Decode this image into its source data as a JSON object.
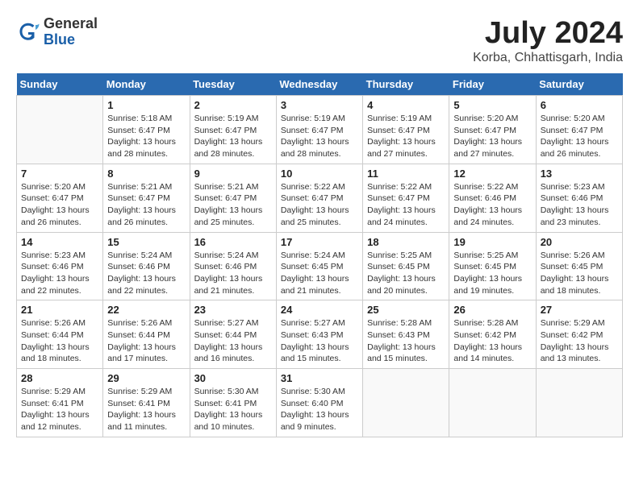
{
  "header": {
    "logo_general": "General",
    "logo_blue": "Blue",
    "month_year": "July 2024",
    "location": "Korba, Chhattisgarh, India"
  },
  "weekdays": [
    "Sunday",
    "Monday",
    "Tuesday",
    "Wednesday",
    "Thursday",
    "Friday",
    "Saturday"
  ],
  "weeks": [
    [
      {
        "day": "",
        "info": ""
      },
      {
        "day": "1",
        "info": "Sunrise: 5:18 AM\nSunset: 6:47 PM\nDaylight: 13 hours\nand 28 minutes."
      },
      {
        "day": "2",
        "info": "Sunrise: 5:19 AM\nSunset: 6:47 PM\nDaylight: 13 hours\nand 28 minutes."
      },
      {
        "day": "3",
        "info": "Sunrise: 5:19 AM\nSunset: 6:47 PM\nDaylight: 13 hours\nand 28 minutes."
      },
      {
        "day": "4",
        "info": "Sunrise: 5:19 AM\nSunset: 6:47 PM\nDaylight: 13 hours\nand 27 minutes."
      },
      {
        "day": "5",
        "info": "Sunrise: 5:20 AM\nSunset: 6:47 PM\nDaylight: 13 hours\nand 27 minutes."
      },
      {
        "day": "6",
        "info": "Sunrise: 5:20 AM\nSunset: 6:47 PM\nDaylight: 13 hours\nand 26 minutes."
      }
    ],
    [
      {
        "day": "7",
        "info": "Sunrise: 5:20 AM\nSunset: 6:47 PM\nDaylight: 13 hours\nand 26 minutes."
      },
      {
        "day": "8",
        "info": "Sunrise: 5:21 AM\nSunset: 6:47 PM\nDaylight: 13 hours\nand 26 minutes."
      },
      {
        "day": "9",
        "info": "Sunrise: 5:21 AM\nSunset: 6:47 PM\nDaylight: 13 hours\nand 25 minutes."
      },
      {
        "day": "10",
        "info": "Sunrise: 5:22 AM\nSunset: 6:47 PM\nDaylight: 13 hours\nand 25 minutes."
      },
      {
        "day": "11",
        "info": "Sunrise: 5:22 AM\nSunset: 6:47 PM\nDaylight: 13 hours\nand 24 minutes."
      },
      {
        "day": "12",
        "info": "Sunrise: 5:22 AM\nSunset: 6:46 PM\nDaylight: 13 hours\nand 24 minutes."
      },
      {
        "day": "13",
        "info": "Sunrise: 5:23 AM\nSunset: 6:46 PM\nDaylight: 13 hours\nand 23 minutes."
      }
    ],
    [
      {
        "day": "14",
        "info": "Sunrise: 5:23 AM\nSunset: 6:46 PM\nDaylight: 13 hours\nand 22 minutes."
      },
      {
        "day": "15",
        "info": "Sunrise: 5:24 AM\nSunset: 6:46 PM\nDaylight: 13 hours\nand 22 minutes."
      },
      {
        "day": "16",
        "info": "Sunrise: 5:24 AM\nSunset: 6:46 PM\nDaylight: 13 hours\nand 21 minutes."
      },
      {
        "day": "17",
        "info": "Sunrise: 5:24 AM\nSunset: 6:45 PM\nDaylight: 13 hours\nand 21 minutes."
      },
      {
        "day": "18",
        "info": "Sunrise: 5:25 AM\nSunset: 6:45 PM\nDaylight: 13 hours\nand 20 minutes."
      },
      {
        "day": "19",
        "info": "Sunrise: 5:25 AM\nSunset: 6:45 PM\nDaylight: 13 hours\nand 19 minutes."
      },
      {
        "day": "20",
        "info": "Sunrise: 5:26 AM\nSunset: 6:45 PM\nDaylight: 13 hours\nand 18 minutes."
      }
    ],
    [
      {
        "day": "21",
        "info": "Sunrise: 5:26 AM\nSunset: 6:44 PM\nDaylight: 13 hours\nand 18 minutes."
      },
      {
        "day": "22",
        "info": "Sunrise: 5:26 AM\nSunset: 6:44 PM\nDaylight: 13 hours\nand 17 minutes."
      },
      {
        "day": "23",
        "info": "Sunrise: 5:27 AM\nSunset: 6:44 PM\nDaylight: 13 hours\nand 16 minutes."
      },
      {
        "day": "24",
        "info": "Sunrise: 5:27 AM\nSunset: 6:43 PM\nDaylight: 13 hours\nand 15 minutes."
      },
      {
        "day": "25",
        "info": "Sunrise: 5:28 AM\nSunset: 6:43 PM\nDaylight: 13 hours\nand 15 minutes."
      },
      {
        "day": "26",
        "info": "Sunrise: 5:28 AM\nSunset: 6:42 PM\nDaylight: 13 hours\nand 14 minutes."
      },
      {
        "day": "27",
        "info": "Sunrise: 5:29 AM\nSunset: 6:42 PM\nDaylight: 13 hours\nand 13 minutes."
      }
    ],
    [
      {
        "day": "28",
        "info": "Sunrise: 5:29 AM\nSunset: 6:41 PM\nDaylight: 13 hours\nand 12 minutes."
      },
      {
        "day": "29",
        "info": "Sunrise: 5:29 AM\nSunset: 6:41 PM\nDaylight: 13 hours\nand 11 minutes."
      },
      {
        "day": "30",
        "info": "Sunrise: 5:30 AM\nSunset: 6:41 PM\nDaylight: 13 hours\nand 10 minutes."
      },
      {
        "day": "31",
        "info": "Sunrise: 5:30 AM\nSunset: 6:40 PM\nDaylight: 13 hours\nand 9 minutes."
      },
      {
        "day": "",
        "info": ""
      },
      {
        "day": "",
        "info": ""
      },
      {
        "day": "",
        "info": ""
      }
    ]
  ]
}
